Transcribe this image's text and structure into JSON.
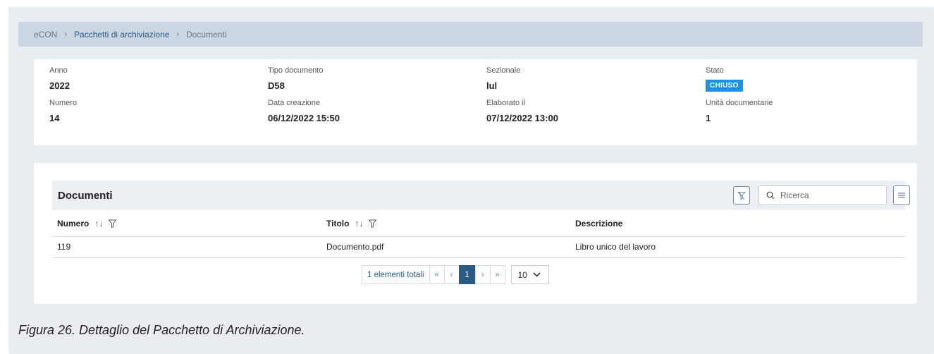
{
  "breadcrumb": {
    "root": "eCON",
    "level1": "Pacchetti di archiviazione",
    "level2": "Documenti"
  },
  "info": {
    "anno": {
      "label": "Anno",
      "value": "2022"
    },
    "tipo_documento": {
      "label": "Tipo documento",
      "value": "D58"
    },
    "sezionale": {
      "label": "Sezionale",
      "value": "lul"
    },
    "stato": {
      "label": "Stato",
      "value": "CHIUSO"
    },
    "numero": {
      "label": "Numero",
      "value": "14"
    },
    "data_creazione": {
      "label": "Data creazione",
      "value": "06/12/2022 15:50"
    },
    "elaborato_il": {
      "label": "Elaborato il",
      "value": "07/12/2022 13:00"
    },
    "unita_documentarie": {
      "label": "Unità documentarie",
      "value": "1"
    }
  },
  "table": {
    "title": "Documenti",
    "search_placeholder": "Ricerca",
    "columns": [
      {
        "label": "Numero",
        "sort": "↑↓"
      },
      {
        "label": "Titolo",
        "sort": "↑↓"
      },
      {
        "label": "Descrizione"
      }
    ],
    "rows": [
      {
        "numero": "119",
        "titolo": "Documento.pdf",
        "descrizione": "Libro unico del lavoro"
      }
    ],
    "pager": {
      "total": "1 elementi totali",
      "first": "«",
      "prev": "‹",
      "page": "1",
      "next": "›",
      "last": "»",
      "rows_per_page": "10"
    }
  },
  "caption": "Figura 26. Dettaglio del Pacchetto di Archiviazione.",
  "colors": {
    "accent": "#2b5a84",
    "badge": "#1e90e6",
    "breadcrumb_bg": "#cbd6e2"
  }
}
